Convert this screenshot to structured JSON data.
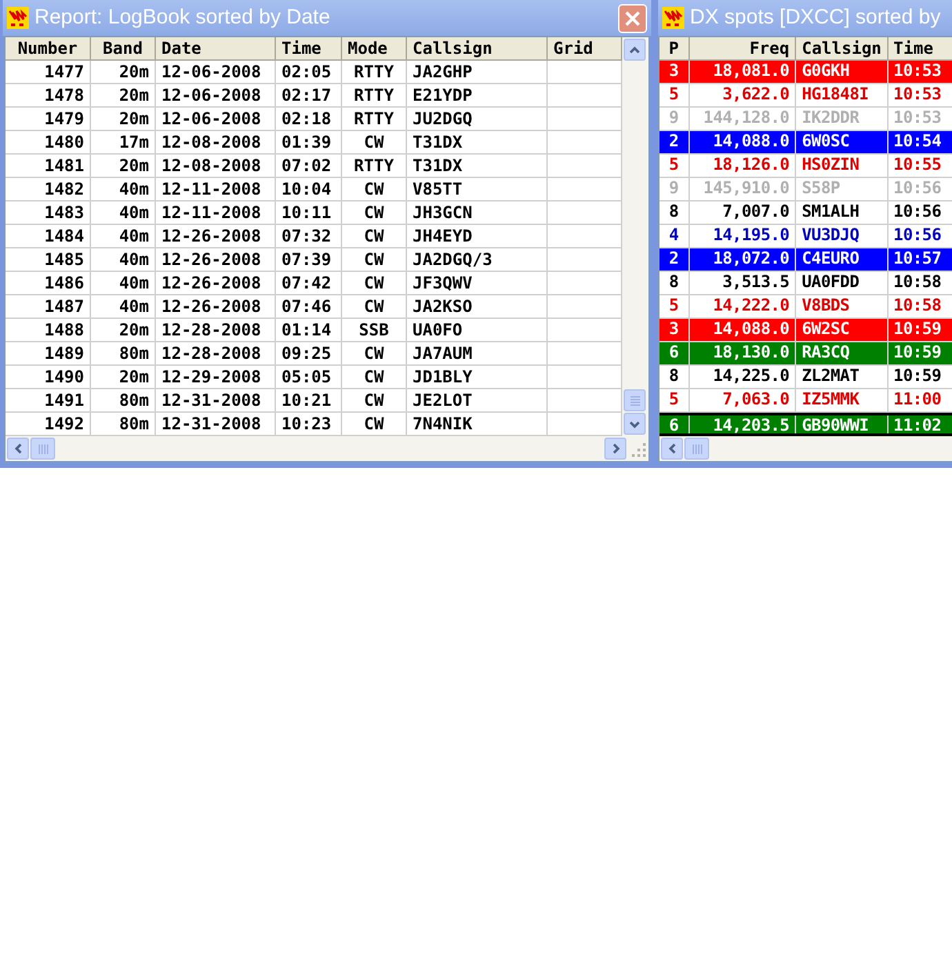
{
  "logbook": {
    "title": "Report: LogBook sorted by Date",
    "columns": [
      "Number",
      "Band",
      "Date",
      "Time",
      "Mode",
      "Callsign",
      "Grid"
    ],
    "rows": [
      [
        "1477",
        "20m",
        "12-06-2008",
        "02:05",
        "RTTY",
        "JA2GHP"
      ],
      [
        "1478",
        "20m",
        "12-06-2008",
        "02:17",
        "RTTY",
        "E21YDP"
      ],
      [
        "1479",
        "20m",
        "12-06-2008",
        "02:18",
        "RTTY",
        "JU2DGQ"
      ],
      [
        "1480",
        "17m",
        "12-08-2008",
        "01:39",
        "CW",
        "T31DX"
      ],
      [
        "1481",
        "20m",
        "12-08-2008",
        "07:02",
        "RTTY",
        "T31DX"
      ],
      [
        "1482",
        "40m",
        "12-11-2008",
        "10:04",
        "CW",
        "V85TT"
      ],
      [
        "1483",
        "40m",
        "12-11-2008",
        "10:11",
        "CW",
        "JH3GCN"
      ],
      [
        "1484",
        "40m",
        "12-26-2008",
        "07:32",
        "CW",
        "JH4EYD"
      ],
      [
        "1485",
        "40m",
        "12-26-2008",
        "07:39",
        "CW",
        "JA2DGQ/3"
      ],
      [
        "1486",
        "40m",
        "12-26-2008",
        "07:42",
        "CW",
        "JF3QWV"
      ],
      [
        "1487",
        "40m",
        "12-26-2008",
        "07:46",
        "CW",
        "JA2KSO"
      ],
      [
        "1488",
        "20m",
        "12-28-2008",
        "01:14",
        "SSB",
        "UA0FO"
      ],
      [
        "1489",
        "80m",
        "12-28-2008",
        "09:25",
        "CW",
        "JA7AUM"
      ],
      [
        "1490",
        "20m",
        "12-29-2008",
        "05:05",
        "CW",
        "JD1BLY"
      ],
      [
        "1491",
        "80m",
        "12-31-2008",
        "10:21",
        "CW",
        "JE2LOT"
      ],
      [
        "1492",
        "80m",
        "12-31-2008",
        "10:23",
        "CW",
        "7N4NIK"
      ]
    ]
  },
  "dx_spots": {
    "title": "DX spots [DXCC] sorted by",
    "columns": [
      "P",
      "Freq",
      "Callsign",
      "Time"
    ],
    "rows": [
      {
        "p": "3",
        "freq": "18,081.0",
        "call": "G0GKH",
        "time": "10:53",
        "kind": "alert",
        "selected": false
      },
      {
        "p": "5",
        "freq": "3,622.0",
        "call": "HG1848I",
        "time": "10:53",
        "kind": "red",
        "selected": false
      },
      {
        "p": "9",
        "freq": "144,128.0",
        "call": "IK2DDR",
        "time": "10:53",
        "kind": "grey",
        "selected": false
      },
      {
        "p": "2",
        "freq": "14,088.0",
        "call": "6W0SC",
        "time": "10:54",
        "kind": "highlight",
        "selected": false
      },
      {
        "p": "5",
        "freq": "18,126.0",
        "call": "HS0ZIN",
        "time": "10:55",
        "kind": "red",
        "selected": false
      },
      {
        "p": "9",
        "freq": "145,910.0",
        "call": "S58P",
        "time": "10:56",
        "kind": "grey",
        "selected": false
      },
      {
        "p": "8",
        "freq": "7,007.0",
        "call": "SM1ALH",
        "time": "10:56",
        "kind": "black",
        "selected": false
      },
      {
        "p": "4",
        "freq": "14,195.0",
        "call": "VU3DJQ",
        "time": "10:56",
        "kind": "blue",
        "selected": false
      },
      {
        "p": "2",
        "freq": "18,072.0",
        "call": "C4EURO",
        "time": "10:57",
        "kind": "highlight",
        "selected": false
      },
      {
        "p": "8",
        "freq": "3,513.5",
        "call": "UA0FDD",
        "time": "10:58",
        "kind": "black",
        "selected": false
      },
      {
        "p": "5",
        "freq": "14,222.0",
        "call": "V8BDS",
        "time": "10:58",
        "kind": "red",
        "selected": false
      },
      {
        "p": "3",
        "freq": "14,088.0",
        "call": "6W2SC",
        "time": "10:59",
        "kind": "alert",
        "selected": false
      },
      {
        "p": "6",
        "freq": "18,130.0",
        "call": "RA3CQ",
        "time": "10:59",
        "kind": "new",
        "selected": false
      },
      {
        "p": "8",
        "freq": "14,225.0",
        "call": "ZL2MAT",
        "time": "10:59",
        "kind": "black",
        "selected": false
      },
      {
        "p": "5",
        "freq": "7,063.0",
        "call": "IZ5MMK",
        "time": "11:00",
        "kind": "red",
        "selected": false
      },
      {
        "p": "6",
        "freq": "14,203.5",
        "call": "GB90WWI",
        "time": "11:02",
        "kind": "new",
        "selected": true
      }
    ]
  }
}
